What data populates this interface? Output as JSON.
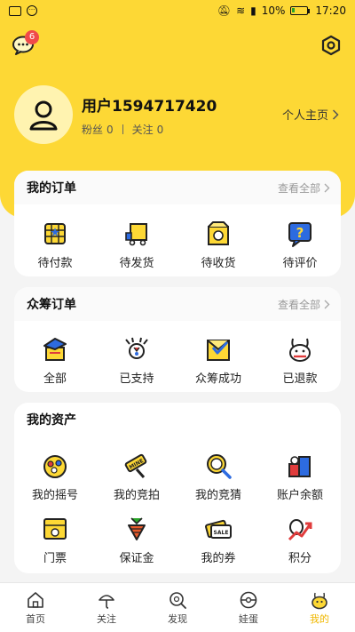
{
  "status_bar": {
    "time": "17:20",
    "battery": "10%"
  },
  "header": {
    "message_badge": "6"
  },
  "profile": {
    "username": "用户1594717420",
    "fans_label": "粉丝",
    "fans_count": "0",
    "follow_label": "关注",
    "follow_count": "0",
    "home_link": "个人主页"
  },
  "orders": {
    "title": "我的订单",
    "more": "查看全部",
    "items": [
      {
        "label": "待付款",
        "icon": "pending-payment-icon"
      },
      {
        "label": "待发货",
        "icon": "pending-shipment-icon"
      },
      {
        "label": "待收货",
        "icon": "pending-receipt-icon"
      },
      {
        "label": "待评价",
        "icon": "pending-review-icon"
      }
    ]
  },
  "crowdfunding": {
    "title": "众筹订单",
    "more": "查看全部",
    "items": [
      {
        "label": "全部",
        "icon": "all-orders-icon"
      },
      {
        "label": "已支持",
        "icon": "supported-icon"
      },
      {
        "label": "众筹成功",
        "icon": "crowdfund-success-icon"
      },
      {
        "label": "已退款",
        "icon": "refunded-icon"
      }
    ]
  },
  "assets": {
    "title": "我的资产",
    "items": [
      {
        "label": "我的摇号",
        "icon": "lottery-icon"
      },
      {
        "label": "我的竞拍",
        "icon": "auction-icon"
      },
      {
        "label": "我的竞猜",
        "icon": "guess-icon"
      },
      {
        "label": "账户余额",
        "icon": "balance-icon"
      },
      {
        "label": "门票",
        "icon": "ticket-icon"
      },
      {
        "label": "保证金",
        "icon": "deposit-icon"
      },
      {
        "label": "我的券",
        "icon": "coupon-icon"
      },
      {
        "label": "积分",
        "icon": "points-icon"
      }
    ]
  },
  "tabbar": {
    "items": [
      {
        "label": "首页",
        "icon": "home-icon"
      },
      {
        "label": "关注",
        "icon": "follow-icon"
      },
      {
        "label": "发现",
        "icon": "discover-icon"
      },
      {
        "label": "娃蛋",
        "icon": "egg-icon"
      },
      {
        "label": "我的",
        "icon": "mine-icon"
      }
    ],
    "active_index": 4,
    "active_color": "#f0b800"
  },
  "colors": {
    "brand_yellow": "#fdd835",
    "badge_red": "#f04a4a"
  }
}
